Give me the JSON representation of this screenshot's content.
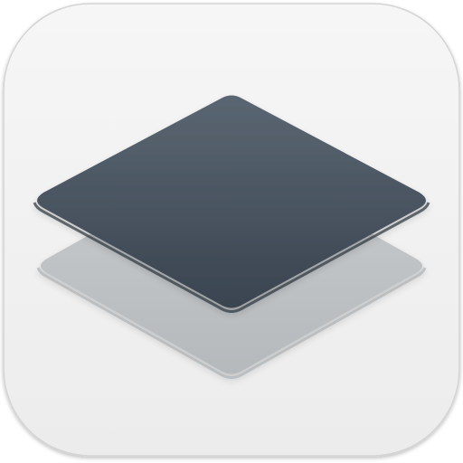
{
  "icon": {
    "name": "layers-icon",
    "colors": {
      "tile_background": "#f1f1f1",
      "tile_edge_shadow": "#c8c8c8",
      "top_layer_light": "#5a6672",
      "top_layer_dark": "#3a4450",
      "top_layer_edge": "#2b333c",
      "bottom_layer_light": "#c9ccce",
      "bottom_layer_dark": "#b5b9bc",
      "bottom_layer_edge": "#a3a8ac"
    }
  }
}
